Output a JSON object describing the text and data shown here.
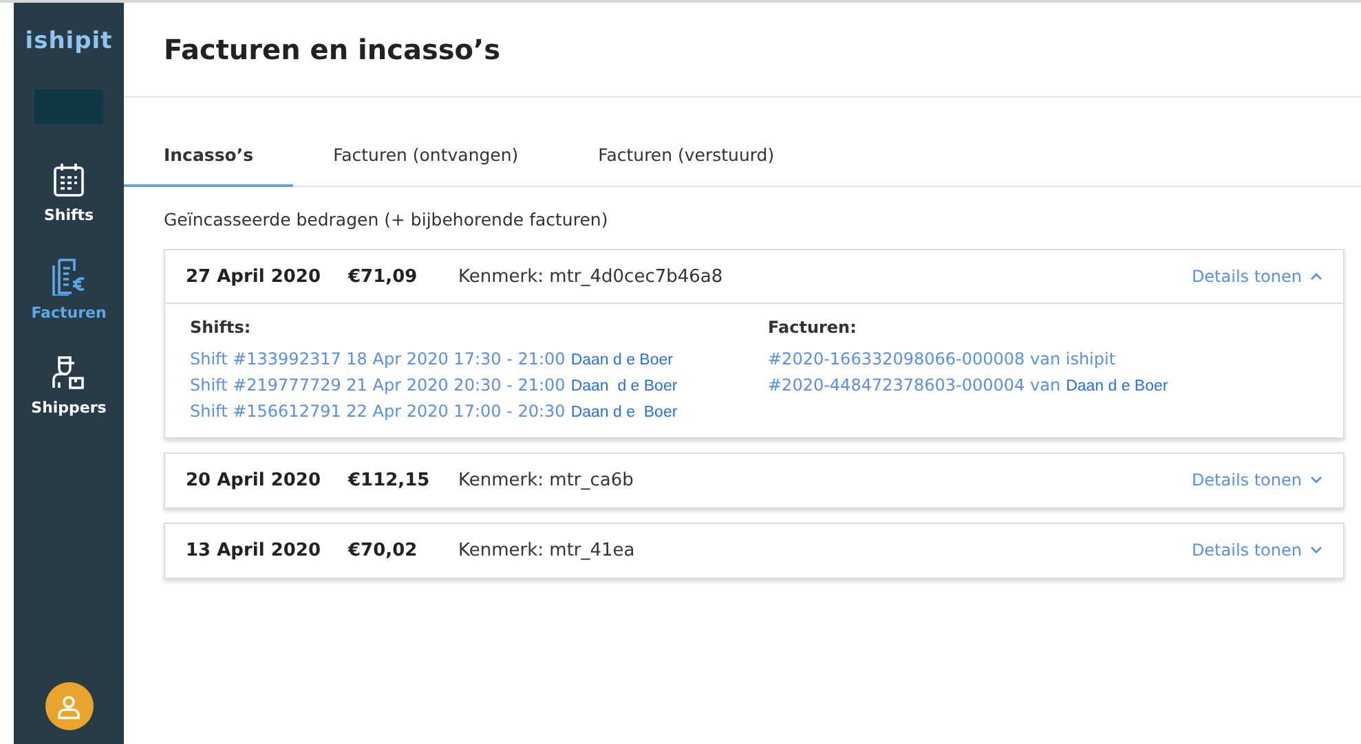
{
  "sidebar": {
    "logo": "ishipit",
    "items": [
      {
        "label": "Shifts",
        "kind": "calendar",
        "selected": false
      },
      {
        "label": "Facturen",
        "kind": "invoice",
        "selected": true
      },
      {
        "label": "Shippers",
        "kind": "shipper",
        "selected": false
      }
    ]
  },
  "page_title": "Facturen en incasso’s",
  "tabs": [
    {
      "label": "Incasso’s",
      "selected": true
    },
    {
      "label": "Facturen (ontvangen)",
      "selected": false
    },
    {
      "label": "Facturen (verstuurd)",
      "selected": false
    }
  ],
  "subtitle": "Geïncasseerde bedragen (+ bijbehorende facturen)",
  "collections": [
    {
      "date": "27 April 2020",
      "amount": "€71,09",
      "reference": "Kenmerk: mtr_4d0cec7b46a8",
      "toggle": "Details tonen",
      "expanded": true,
      "shifts_heading": "Shifts:",
      "shifts": [
        {
          "text": "Shift #133992317 18 Apr 2020 17:30 - 21:00",
          "name": "Daan d e Boer"
        },
        {
          "text": "Shift #219777729 21 Apr 2020 20:30 - 21:00",
          "name": "Daan  d e Boer"
        },
        {
          "text": "Shift #156612791 22 Apr 2020 17:00 - 20:30",
          "name": "Daan d e  Boer"
        }
      ],
      "invoices_heading": "Facturen:",
      "invoices": [
        {
          "text": "#2020-166332098066-000008 van ishipit"
        },
        {
          "text": "#2020-448472378603-000004 van",
          "name": "Daan d e Boer"
        }
      ]
    },
    {
      "date": "20 April 2020",
      "amount": "€112,15",
      "reference": "Kenmerk: mtr_ca6b",
      "toggle": "Details tonen",
      "expanded": false
    },
    {
      "date": "13 April 2020",
      "amount": "€70,02",
      "reference": "Kenmerk: mtr_41ea",
      "toggle": "Details tonen",
      "expanded": false
    }
  ]
}
